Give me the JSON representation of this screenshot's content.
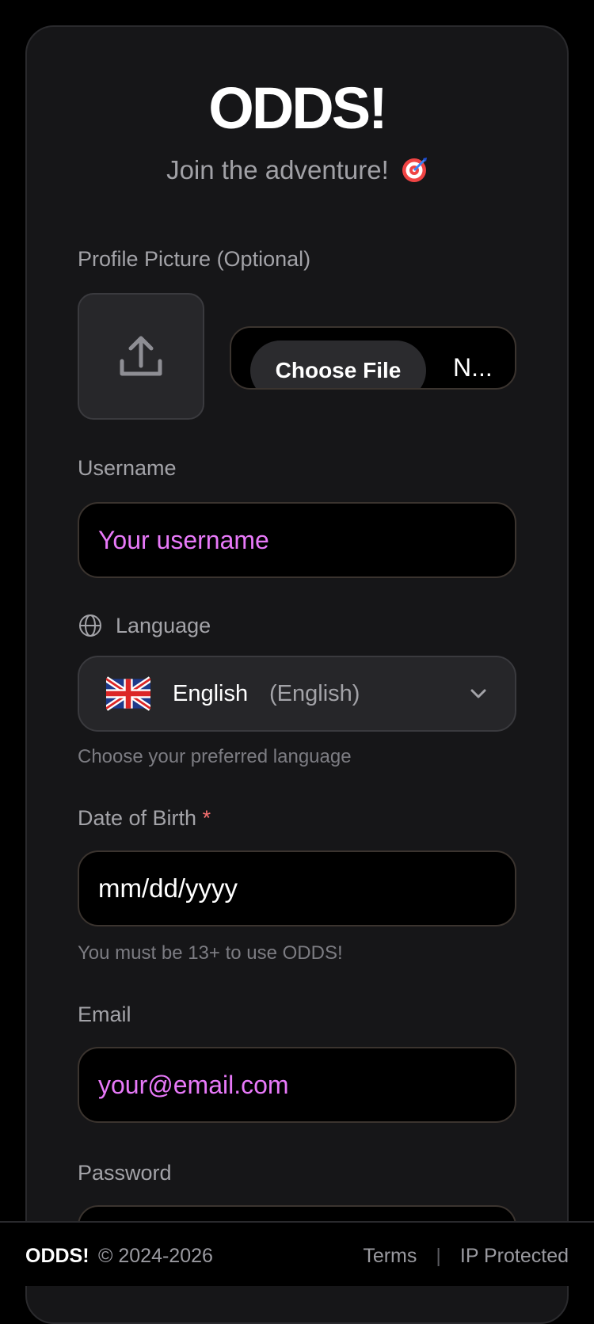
{
  "app": {
    "title": "ODDS!",
    "tagline": "Join the adventure!"
  },
  "profile": {
    "label": "Profile Picture (Optional)",
    "choose_file_label": "Choose File",
    "file_status": "N..."
  },
  "username": {
    "label": "Username",
    "placeholder": "Your username"
  },
  "language": {
    "label": "Language",
    "selected_name": "English",
    "selected_native": "(English)",
    "helper": "Choose your preferred language",
    "flag_icon": "uk-flag-icon"
  },
  "dob": {
    "label": "Date of Birth",
    "required_marker": "*",
    "placeholder": "mm/dd/yyyy",
    "helper": "You must be 13+ to use ODDS!"
  },
  "email": {
    "label": "Email",
    "placeholder": "your@email.com"
  },
  "password": {
    "label": "Password"
  },
  "footer": {
    "brand": "ODDS!",
    "copyright": "© 2024-2026",
    "terms": "Terms",
    "separator": "|",
    "ip": "IP Protected"
  },
  "colors": {
    "accent_placeholder": "#e879f9",
    "required": "#f87171",
    "card_bg": "#161618",
    "page_bg": "#000000"
  }
}
